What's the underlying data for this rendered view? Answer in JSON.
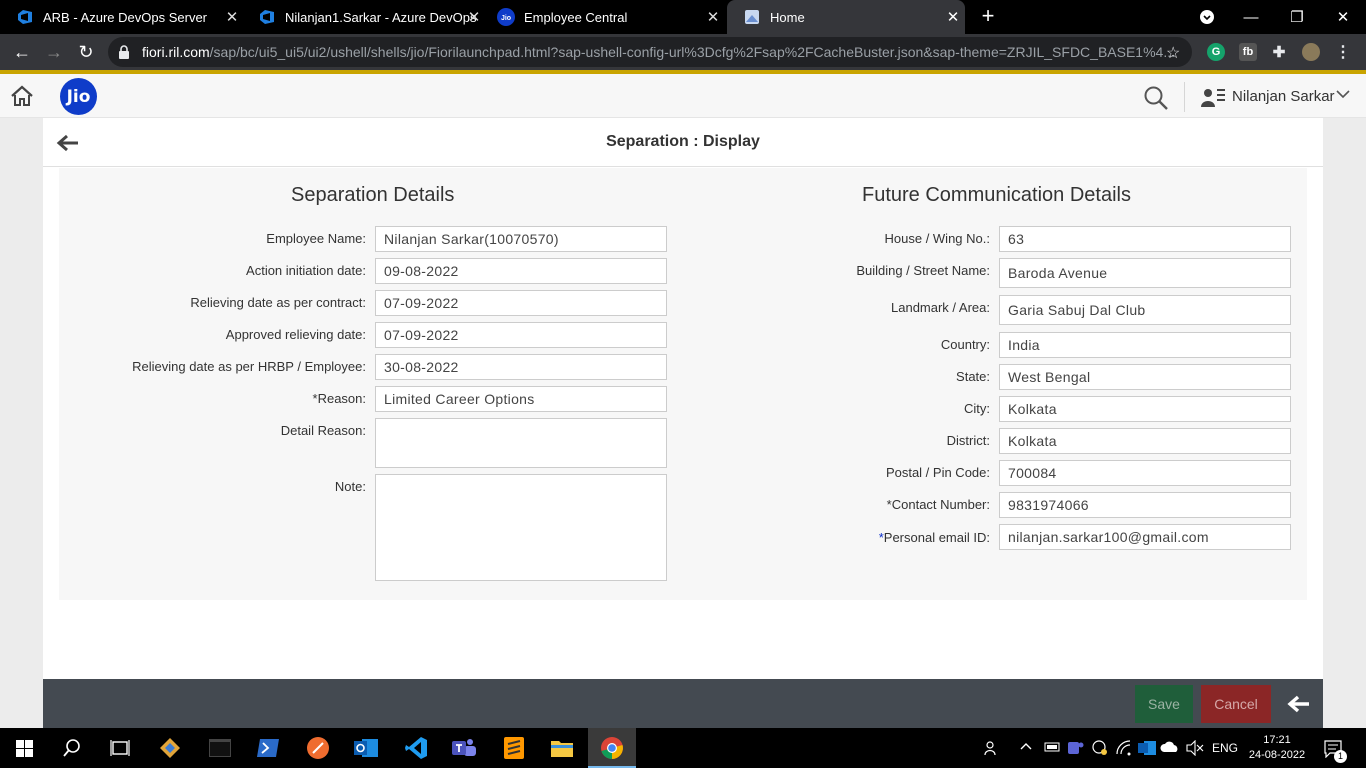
{
  "browser": {
    "tabs": [
      {
        "title": "ARB - Azure DevOps Server",
        "icon": "azure-devops-icon"
      },
      {
        "title": "Nilanjan1.Sarkar - Azure DevOps",
        "icon": "azure-devops-icon"
      },
      {
        "title": "Employee Central",
        "icon": "jio-icon"
      },
      {
        "title": "Home",
        "icon": "page-icon",
        "active": true
      }
    ],
    "url_host": "fiori.ril.com",
    "url_path": "/sap/bc/ui5_ui5/ui2/ushell/shells/jio/Fiorilaunchpad.html?sap-ushell-config-url%3Dcfg%2Fsap%2FCacheBuster.json&sap-theme=ZRJIL_SFDC_BASE1%4..."
  },
  "shell": {
    "logo_text": "Jio",
    "user_name": "Nilanjan Sarkar"
  },
  "page": {
    "title": "Separation : Display"
  },
  "separation": {
    "title": "Separation Details",
    "fields": [
      {
        "label": "Employee Name:",
        "value": "Nilanjan Sarkar(10070570)"
      },
      {
        "label": "Action initiation date:",
        "value": "09-08-2022"
      },
      {
        "label": "Relieving date as per contract:",
        "value": "07-09-2022"
      },
      {
        "label": "Approved relieving date:",
        "value": "07-09-2022"
      },
      {
        "label": "Relieving date as per HRBP / Employee:",
        "value": "30-08-2022"
      },
      {
        "label": "*Reason:",
        "value": "Limited Career Options"
      },
      {
        "label": "Detail Reason:",
        "value": ""
      },
      {
        "label": "Note:",
        "value": ""
      }
    ]
  },
  "communication": {
    "title": "Future Communication Details",
    "fields": [
      {
        "label": "House / Wing No.:",
        "value": "63"
      },
      {
        "label": "Building / Street Name:",
        "value": "Baroda Avenue"
      },
      {
        "label": "Landmark / Area:",
        "value": "Garia Sabuj Dal Club"
      },
      {
        "label": "Country:",
        "value": "India"
      },
      {
        "label": "State:",
        "value": "West Bengal"
      },
      {
        "label": "City:",
        "value": "Kolkata"
      },
      {
        "label": "District:",
        "value": "Kolkata"
      },
      {
        "label": "Postal / Pin Code:",
        "value": "700084"
      },
      {
        "label": "*Contact Number:",
        "value": "9831974066"
      },
      {
        "label": "Personal email ID:",
        "value": "nilanjan.sarkar100@gmail.com",
        "required_mark": "*"
      }
    ]
  },
  "footer": {
    "save_label": "Save",
    "cancel_label": "Cancel"
  },
  "taskbar": {
    "language": "ENG",
    "time": "17:21",
    "date": "24-08-2022",
    "notification_count": "1"
  },
  "colors": {
    "accent": "#c9a400",
    "jio_blue": "#0f3cc9",
    "save_green": "#1f5e3a",
    "cancel_red": "#8b2626",
    "footer_bar": "#444a51"
  }
}
